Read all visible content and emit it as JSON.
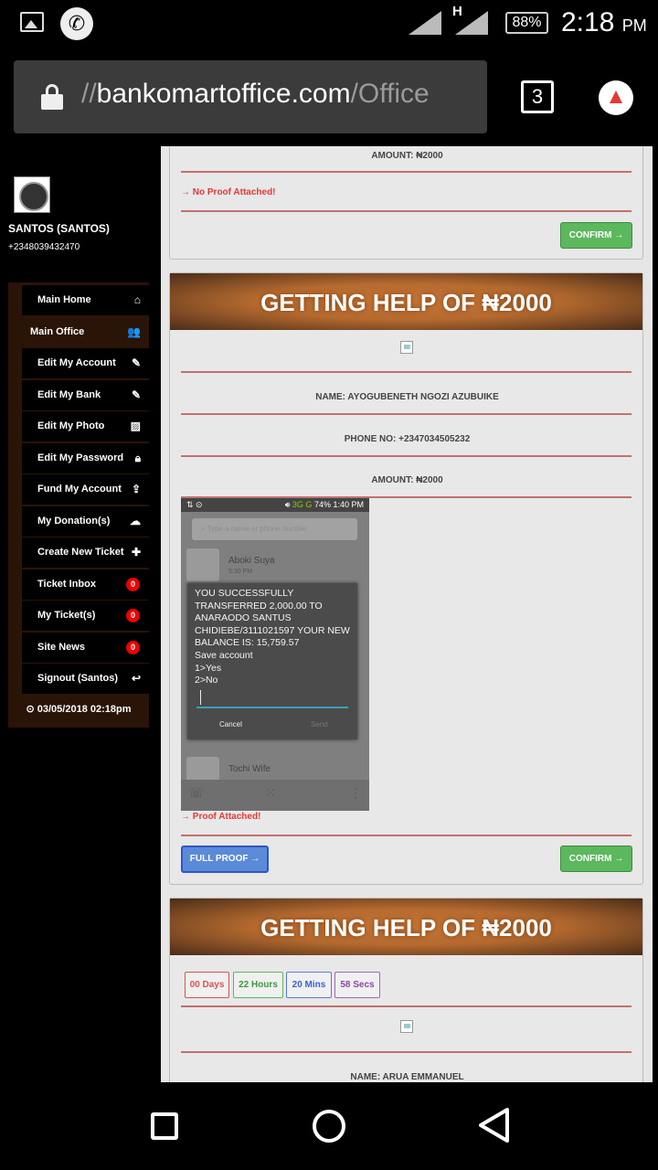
{
  "status_bar": {
    "battery": "88%",
    "time": "2:18",
    "ampm": "PM",
    "network_type": "H"
  },
  "browser": {
    "url_prefix": "//",
    "url_domain": "bankomartoffice.com",
    "url_path": "/Office",
    "tab_count": "3"
  },
  "sidebar": {
    "user_name": "SANTOS (SANTOS)",
    "user_phone": "+2348039432470",
    "items": [
      {
        "label": "Main Home",
        "icon": "home-icon"
      },
      {
        "label": "Main Office",
        "icon": "users-icon"
      },
      {
        "label": "Edit My Account",
        "icon": "pencil-icon"
      },
      {
        "label": "Edit My Bank",
        "icon": "pencil-icon"
      },
      {
        "label": "Edit My Photo",
        "icon": "image-icon"
      },
      {
        "label": "Edit My Password",
        "icon": "lock-icon"
      },
      {
        "label": "Fund My Account",
        "icon": "upload-icon"
      },
      {
        "label": "My Donation(s)",
        "icon": "cloud-icon"
      },
      {
        "label": "Create New Ticket",
        "icon": "plus-icon"
      },
      {
        "label": "Ticket Inbox",
        "badge": "0"
      },
      {
        "label": "My Ticket(s)",
        "badge": "0"
      },
      {
        "label": "Site News",
        "badge": "0"
      },
      {
        "label": "Signout (Santos)",
        "icon": "reply-icon"
      }
    ],
    "datetime": "03/05/2018 02:18pm"
  },
  "card1": {
    "amount": "AMOUNT: ₦2000",
    "proof_status": "→ No Proof Attached!",
    "confirm_label": "CONFIRM →"
  },
  "card2": {
    "title": "GETTING HELP OF ₦2000",
    "name": "NAME: AYOGUBENETH NGOZI AZUBUIKE",
    "phone": "PHONE NO: +2347034505232",
    "amount": "AMOUNT: ₦2000",
    "proof_status": "→ Proof Attached!",
    "full_proof_label": "FULL PROOF →",
    "confirm_label": "CONFIRM →",
    "screenshot": {
      "status_left": "⇅ ⊙",
      "status_net": "3G",
      "status_net2": "G",
      "status_battery": "74%",
      "status_time": "1:40 PM",
      "search_placeholder": "Type a name or phone number",
      "contact1_name": "Aboki Suya",
      "contact1_time": "5:30 PM",
      "message": "YOU SUCCESSFULLY TRANSFERRED 2,000.00 TO ANARAODO SANTUS CHIDIEBE/3111021597 YOUR NEW BALANCE IS: 15,759.57\nSave account\n1>Yes\n2>No",
      "cancel_label": "Cancel",
      "send_label": "Send",
      "contact2_name": "Tochi Wife"
    }
  },
  "card3": {
    "title": "GETTING HELP OF ₦2000",
    "days": "00 Days",
    "hours": "22 Hours",
    "mins": "20 Mins",
    "secs": "58 Secs",
    "name": "NAME: ARUA EMMANUEL"
  },
  "colors": {
    "accent_orange": "#c77637",
    "confirm_green": "#5cb85c",
    "proof_red": "#e53935",
    "sidebar_brown": "#2a1408"
  }
}
